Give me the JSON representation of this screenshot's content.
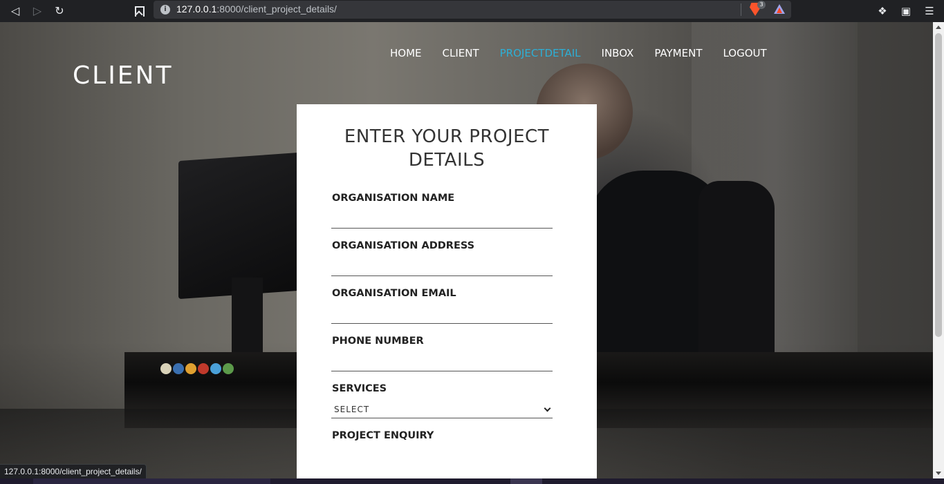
{
  "browser": {
    "url_host": "127.0.0.1",
    "url_rest": ":8000/client_project_details/",
    "info_icon": "i",
    "brave_badge": "3",
    "icons": {
      "back": "back-arrow-icon",
      "forward": "forward-arrow-icon",
      "reload": "reload-icon",
      "bookmark": "bookmark-icon",
      "extensions": "puzzle-icon",
      "wallet": "wallet-icon",
      "menu": "hamburger-menu-icon"
    },
    "status_url": "127.0.0.1:8000/client_project_details/"
  },
  "site": {
    "brand": "CLIENT",
    "accent_color": "#2dafd6",
    "nav": [
      {
        "label": "HOME",
        "active": false
      },
      {
        "label": "CLIENT",
        "active": false
      },
      {
        "label": "PROJECTDETAIL",
        "active": true
      },
      {
        "label": "INBOX",
        "active": false
      },
      {
        "label": "PAYMENT",
        "active": false
      },
      {
        "label": "LOGOUT",
        "active": false
      }
    ]
  },
  "form": {
    "title": "ENTER YOUR PROJECT DETAILS",
    "fields": {
      "org_name": {
        "label": "ORGANISATION NAME",
        "value": ""
      },
      "org_address": {
        "label": "ORGANISATION ADDRESS",
        "value": ""
      },
      "org_email": {
        "label": "ORGANISATION EMAIL",
        "value": ""
      },
      "phone": {
        "label": "PHONE NUMBER",
        "value": ""
      },
      "services": {
        "label": "SERVICES",
        "selected": "SELECT"
      },
      "enquiry": {
        "label": "PROJECT ENQUIRY",
        "value": ""
      }
    }
  }
}
